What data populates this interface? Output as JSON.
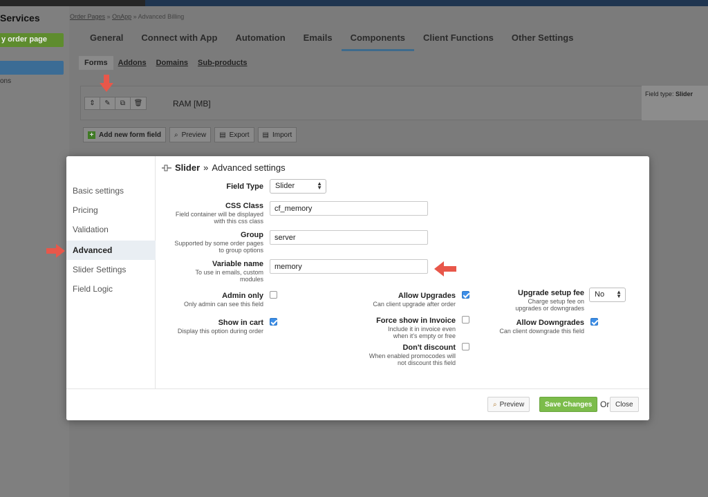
{
  "sidebar": {
    "title": "Services",
    "new_order_page": "y order page",
    "item2": "ons"
  },
  "breadcrumb": {
    "part1": "Order Pages",
    "part2": "OnApp",
    "part3": "Advanced Billing",
    "sep": "»"
  },
  "tabs": [
    {
      "label": "General"
    },
    {
      "label": "Connect with App"
    },
    {
      "label": "Automation"
    },
    {
      "label": "Emails"
    },
    {
      "label": "Components"
    },
    {
      "label": "Client Functions"
    },
    {
      "label": "Other Settings"
    }
  ],
  "subtabs": [
    {
      "label": "Forms"
    },
    {
      "label": "Addons"
    },
    {
      "label": "Domains"
    },
    {
      "label": "Sub-products"
    }
  ],
  "field_row": {
    "name": "RAM [MB]",
    "field_type_label": "Field type:",
    "field_type_value": "Slider"
  },
  "actions": {
    "add": "Add new form field",
    "preview": "Preview",
    "export": "Export",
    "import": "Import"
  },
  "modal": {
    "title_prefix": "Slider",
    "title_sep": "»",
    "title": "Advanced settings",
    "nav": [
      {
        "label": "Basic settings"
      },
      {
        "label": "Pricing"
      },
      {
        "label": "Validation"
      },
      {
        "label": "Advanced"
      },
      {
        "label": "Slider Settings"
      },
      {
        "label": "Field Logic"
      }
    ],
    "field_type": {
      "label": "Field Type",
      "value": "Slider"
    },
    "css_class": {
      "label": "CSS Class",
      "hint1": "Field container will be displayed",
      "hint2": "with this css class",
      "value": "cf_memory"
    },
    "group": {
      "label": "Group",
      "hint1": "Supported by some order pages",
      "hint2": "to group options",
      "value": "server"
    },
    "variable_name": {
      "label": "Variable name",
      "hint1": "To use in emails, custom",
      "hint2": "modules",
      "value": "memory"
    },
    "admin_only": {
      "label": "Admin only",
      "hint": "Only admin can see this field",
      "checked": false
    },
    "show_in_cart": {
      "label": "Show in cart",
      "hint": "Display this option during order",
      "checked": true
    },
    "allow_upgrades": {
      "label": "Allow Upgrades",
      "hint": "Can client upgrade after order",
      "checked": true
    },
    "force_show_invoice": {
      "label": "Force show in Invoice",
      "hint1": "Include it in invoice even",
      "hint2": "when it's empty or free",
      "checked": false
    },
    "dont_discount": {
      "label": "Don't discount",
      "hint1": "When enabled promocodes will",
      "hint2": "not discount this field",
      "checked": false
    },
    "upgrade_setup_fee": {
      "label": "Upgrade setup fee",
      "hint1": "Charge setup fee on",
      "hint2": "upgrades or downgrades",
      "value": "No"
    },
    "allow_downgrades": {
      "label": "Allow Downgrades",
      "hint": "Can client downgrade this field",
      "checked": true
    },
    "footer": {
      "preview": "Preview",
      "save": "Save Changes",
      "or": "Or",
      "close": "Close"
    }
  },
  "colors": {
    "accent_blue": "#3c8ee8",
    "save_green": "#7cbc4b",
    "arrow_red": "#e8574a"
  }
}
